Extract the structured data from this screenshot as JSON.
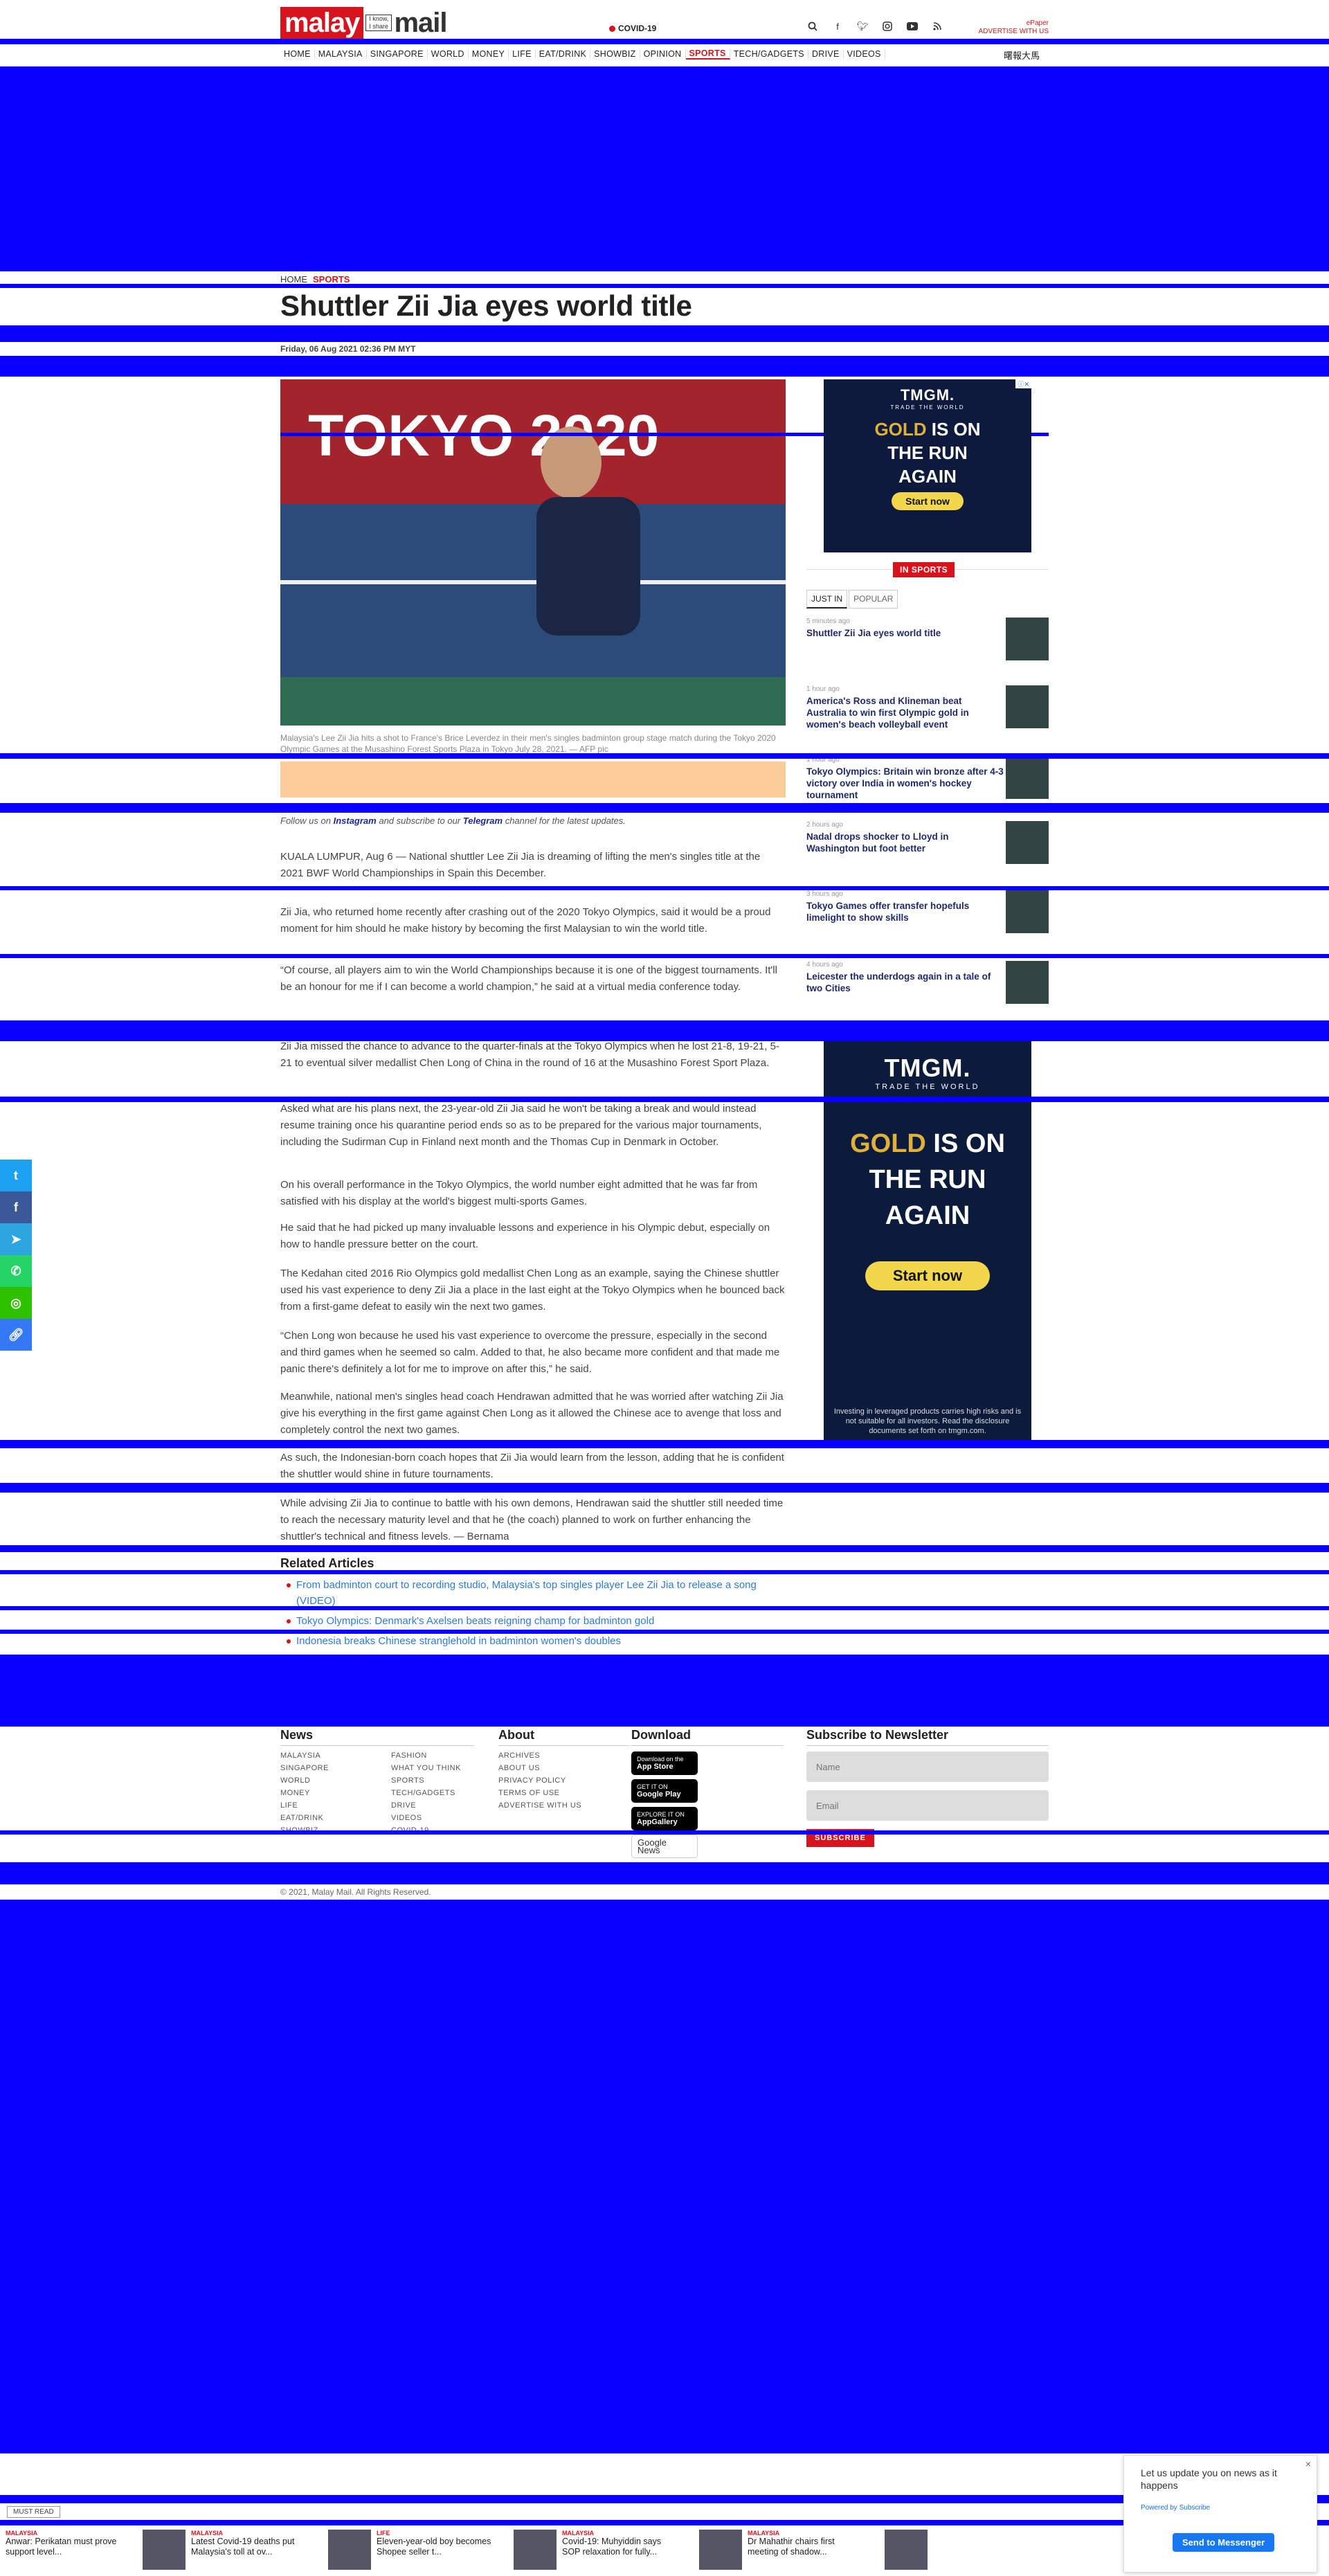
{
  "header": {
    "logo_left": "malay",
    "logo_tag_1": "I know,",
    "logo_tag_2": "I share",
    "logo_right": "mail",
    "covid_label": "COVID-19",
    "top_link_1": "ePaper",
    "top_link_2": "ADVERTISE WITH US",
    "icons": [
      "search-icon",
      "facebook-icon",
      "twitter-icon",
      "instagram-icon",
      "youtube-icon",
      "rss-icon"
    ]
  },
  "nav": {
    "items": [
      "HOME",
      "MALAYSIA",
      "SINGAPORE",
      "WORLD",
      "MONEY",
      "LIFE",
      "EAT/DRINK",
      "SHOWBIZ",
      "OPINION",
      "SPORTS",
      "TECH/GADGETS",
      "DRIVE",
      "VIDEOS"
    ],
    "active": "SPORTS",
    "chinese": "曙報大馬"
  },
  "article": {
    "breadcrumb_home": "HOME",
    "breadcrumb_section": "SPORTS",
    "title": "Shuttler Zii Jia eyes world title",
    "date": "Friday, 06 Aug 2021 02:36 PM MYT",
    "photo_text": "TOKYO 2020",
    "caption": "Malaysia's Lee Zii Jia hits a shot to France's Brice Leverdez in their men's singles badminton group stage match during the Tokyo 2020 Olympic Games at the Musashino Forest Sports Plaza in Tokyo July 28, 2021. — AFP pic",
    "follow_pre": "Follow us on ",
    "follow_instagram": "Instagram",
    "follow_mid": " and subscribe to our ",
    "follow_telegram": "Telegram",
    "follow_post": " channel for the latest updates.",
    "paragraphs": [
      "KUALA LUMPUR, Aug 6 — National shuttler Lee Zii Jia is dreaming of lifting the men's singles title at the 2021 BWF World Championships in Spain this December.",
      "Zii Jia, who returned home recently after crashing out of the 2020 Tokyo Olympics, said it would be a proud moment for him should he make history by becoming the first Malaysian to win the world title.",
      "“Of course, all players aim to win the World Championships because it is one of the biggest tournaments. It'll be an honour for me if I can become a world champion,” he said at a virtual media conference today.",
      "Zii Jia missed the chance to advance to the quarter-finals at the Tokyo Olympics when he lost 21-8, 19-21, 5-21 to eventual silver medallist Chen Long of China in the round of 16 at the Musashino Forest Sport Plaza.",
      "Asked what are his plans next, the 23-year-old Zii Jia said he won't be taking a break and would instead resume training once his quarantine period ends so as to be prepared for the various major tournaments, including the Sudirman Cup in Finland next month and the Thomas Cup in Denmark in October.",
      "On his overall performance in the Tokyo Olympics, the world number eight admitted that he was far from satisfied with his display at the world's biggest multi-sports Games.",
      "He said that he had picked up many invaluable lessons and experience in his Olympic debut, especially on how to handle pressure better on the court.",
      "The Kedahan cited 2016 Rio Olympics gold medallist Chen Long as an example, saying the Chinese shuttler used his vast experience to deny Zii Jia a place in the last eight at the Tokyo Olympics when he bounced back from a first-game defeat to easily win the next two games.",
      "“Chen Long won because he used his vast experience to overcome the pressure, especially in the second and third games when he seemed so calm. Added to that, he also became more confident and that made me panic there's definitely a lot for me to improve on after this,” he said.",
      "Meanwhile, national men's singles head coach Hendrawan admitted that he was worried after watching Zii Jia give his everything in the first game against Chen Long as it allowed the Chinese ace to avenge that loss and completely control the next two games.",
      "As such, the Indonesian-born coach hopes that Zii Jia would learn from the lesson, adding that he is confident the shuttler would shine in future tournaments.",
      "While advising Zii Jia to continue to battle with his own demons, Hendrawan said the shuttler still needed time to reach the necessary maturity level and that he (the coach) planned to work on further enhancing the shuttler's technical and fitness levels. — Bernama"
    ],
    "related_heading": "Related Articles",
    "related": [
      "From badminton court to recording studio, Malaysia's top singles player Lee Zii Jia to release a song (VIDEO)",
      "Tokyo Olympics: Denmark's Axelsen beats reigning champ for badminton gold",
      "Indonesia breaks Chinese stranglehold in badminton women's doubles"
    ]
  },
  "sidebar": {
    "ad_brand": "TMGM.",
    "ad_tagline": "TRADE THE WORLD",
    "ad_line_gold": "GOLD",
    "ad_line_1": " IS ON",
    "ad_line_2": "THE RUN",
    "ad_line_3": "AGAIN",
    "ad_button": "Start now",
    "ad_close": "ⓘ✕",
    "ad_disclaimer": "Investing in leveraged products carries high risks and is not suitable for all investors. Read the disclosure documents set forth on tmgm.com.",
    "section_label": "IN SPORTS",
    "tab_just_in": "JUST IN",
    "tab_popular": "POPULAR",
    "items": [
      {
        "ago": "5 minutes ago",
        "title": "Shuttler Zii Jia eyes world title"
      },
      {
        "ago": "1 hour ago",
        "title": "America's Ross and Klineman beat Australia to win first Olympic gold in women's beach volleyball event"
      },
      {
        "ago": "1 hour ago",
        "title": "Tokyo Olympics: Britain win bronze after 4-3 victory over India in women's hockey tournament"
      },
      {
        "ago": "2 hours ago",
        "title": "Nadal drops shocker to Lloyd in Washington but foot better"
      },
      {
        "ago": "3 hours ago",
        "title": "Tokyo Games offer transfer hopefuls limelight to show skills"
      },
      {
        "ago": "4 hours ago",
        "title": "Leicester the underdogs again in a tale of two Cities"
      }
    ]
  },
  "share": {
    "icons": [
      "twitter-icon",
      "facebook-icon",
      "telegram-icon",
      "whatsapp-icon",
      "wechat-icon",
      "link-icon"
    ],
    "colors": [
      "#1da1f2",
      "#3b5998",
      "#2ca5e0",
      "#25d366",
      "#2dc100",
      "#3478f6"
    ]
  },
  "footer": {
    "news_heading": "News",
    "news_col1": [
      "MALAYSIA",
      "SINGAPORE",
      "WORLD",
      "MONEY",
      "LIFE",
      "EAT/DRINK",
      "SHOWBIZ"
    ],
    "news_col2": [
      "FASHION",
      "WHAT YOU THINK",
      "SPORTS",
      "TECH/GADGETS",
      "DRIVE",
      "VIDEOS",
      "COVID-19"
    ],
    "about_heading": "About",
    "about_links": [
      "ARCHIVES",
      "ABOUT US",
      "PRIVACY POLICY",
      "TERMS OF USE",
      "ADVERTISE WITH US"
    ],
    "download_heading": "Download",
    "stores": [
      {
        "top": "Download on the",
        "bottom": "App Store"
      },
      {
        "top": "GET IT ON",
        "bottom": "Google Play"
      },
      {
        "top": "EXPLORE IT ON",
        "bottom": "AppGallery"
      }
    ],
    "google_news": "Google News",
    "newsletter_heading": "Subscribe to Newsletter",
    "name_placeholder": "Name",
    "email_placeholder": "Email",
    "subscribe_label": "SUBSCRIBE",
    "copyright": "© 2021, Malay Mail. All Rights Reserved."
  },
  "bottom_bar": {
    "must_read": "MUST READ",
    "items": [
      {
        "cat": "MALAYSIA",
        "title": "Anwar: Perikatan must prove support level..."
      },
      {
        "cat": "MALAYSIA",
        "title": "Latest Covid-19 deaths put Malaysia's toll at ov..."
      },
      {
        "cat": "LIFE",
        "title": "Eleven-year-old boy becomes Shopee seller t..."
      },
      {
        "cat": "MALAYSIA",
        "title": "Covid-19: Muhyiddin says SOP relaxation for fully..."
      },
      {
        "cat": "MALAYSIA",
        "title": "Dr Mahathir chairs first meeting of shadow..."
      }
    ]
  },
  "messenger": {
    "message": "Let us update you on news as it happens",
    "powered": "Powered by Subscribe",
    "button": "Send to Messenger",
    "close": "×"
  }
}
